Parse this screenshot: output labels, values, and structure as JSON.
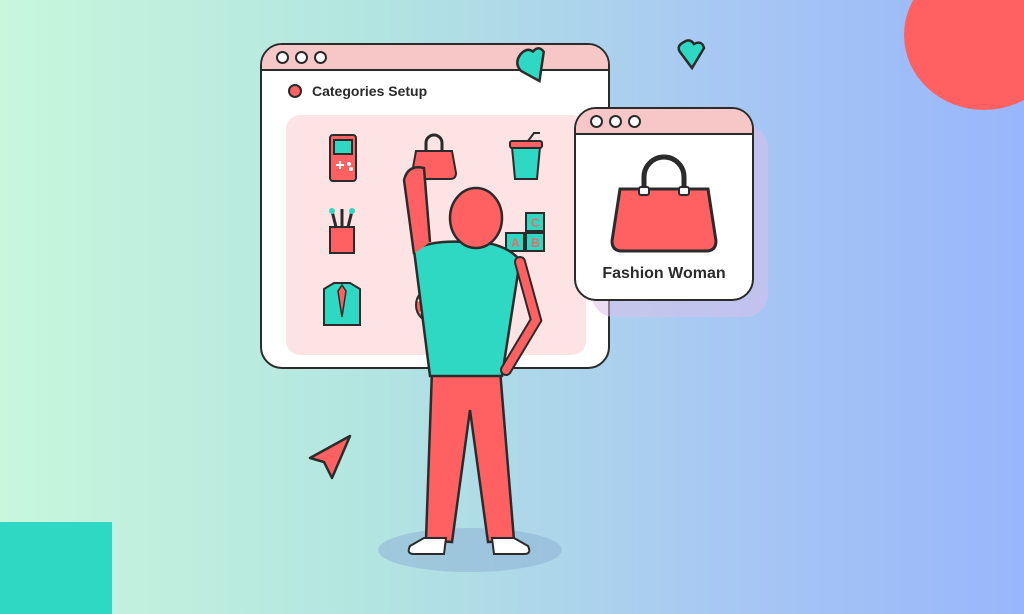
{
  "window": {
    "title": "Categories Setup"
  },
  "categories": [
    {
      "icon": "game-console-icon"
    },
    {
      "icon": "handbag-icon"
    },
    {
      "icon": "drink-cup-icon"
    },
    {
      "icon": "paint-brushes-icon"
    },
    {
      "icon": "toy-blocks-icon"
    },
    {
      "icon": "shirt-tie-icon"
    },
    {
      "icon": "yarn-ball-icon"
    }
  ],
  "detail": {
    "label": "Fashion Woman",
    "icon": "handbag-icon"
  },
  "colors": {
    "accent": "#ff6163",
    "teal": "#2fd8c2",
    "outline": "#2b2b2b",
    "pink": "#f7c7c8"
  }
}
